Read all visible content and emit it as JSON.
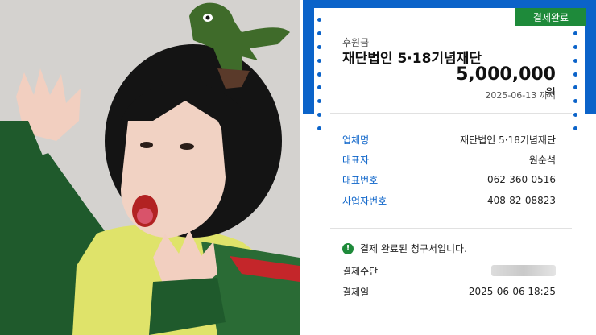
{
  "receipt": {
    "status": "결제완료",
    "sponsor_label": "후원금",
    "org_name": "재단법인 5·18기념재단",
    "amount": "5,000,000",
    "amount_unit": "원",
    "due_date": "2025-06-13 까지",
    "info": [
      {
        "label": "업체명",
        "value": "재단법인 5·18기념재단"
      },
      {
        "label": "대표자",
        "value": "원순석"
      },
      {
        "label": "대표번호",
        "value": "062-360-0516"
      },
      {
        "label": "사업자번호",
        "value": "408-82-08823"
      }
    ],
    "notice": "결제 완료된 청구서입니다.",
    "payment_method_label": "결제수단",
    "payment_date_label": "결제일",
    "payment_date": "2025-06-06 18:25"
  },
  "colors": {
    "accent_blue": "#0b63c9",
    "status_green": "#1e8a3a"
  }
}
